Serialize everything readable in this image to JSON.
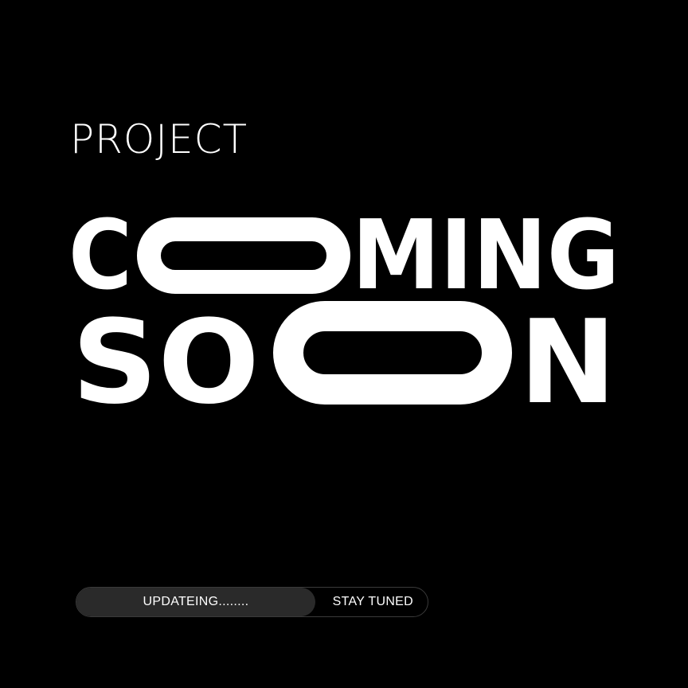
{
  "project_label": "PROJECT",
  "headline": {
    "line1": {
      "before": "C",
      "after": "MING"
    },
    "line2": {
      "before": "SO",
      "after": "N"
    }
  },
  "progress": {
    "label": "UPDATEING........",
    "fraction": 0.68
  },
  "status_label": "STAY TUNED",
  "colors": {
    "background": "#000000",
    "text": "#ffffff",
    "progress_fill": "#2a2a2a",
    "progress_border": "#3a3a3a"
  }
}
